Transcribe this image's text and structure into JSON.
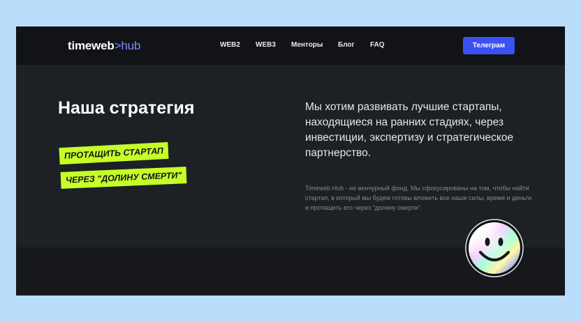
{
  "header": {
    "logo_primary": "timeweb",
    "logo_separator": ">",
    "logo_secondary": "hub",
    "nav": [
      {
        "label": "WEB2"
      },
      {
        "label": "WEB3"
      },
      {
        "label": "Менторы"
      },
      {
        "label": "Блог"
      },
      {
        "label": "FAQ"
      }
    ],
    "cta_label": "Телеграм"
  },
  "hero": {
    "title": "Наша стратегия",
    "tags": [
      "ПРОТАЩИТЬ СТАРТАП",
      "ЧЕРЕЗ \"ДОЛИНУ СМЕРТИ\""
    ],
    "lead": "Мы хотим развивать лучшие стартапы, находящиеся на ранних стадиях, через инвестиции, экспертизу и стратегическое партнерство.",
    "description": "Timeweb Hub - не венчурный фонд. Мы сфокусированы на том, чтобы найти стартап, в который мы будем готовы вложить все наши силы, время и деньги и протащить его через \"долину смерти\"."
  },
  "colors": {
    "background_outer": "#b9ddfa",
    "header_bg": "#121316",
    "main_bg": "#1d2025",
    "accent_blue": "#3c51f2",
    "accent_lime": "#c6ff28",
    "logo_hub": "#7e8cff"
  },
  "icons": {
    "badge": "holographic-smiley-icon"
  }
}
